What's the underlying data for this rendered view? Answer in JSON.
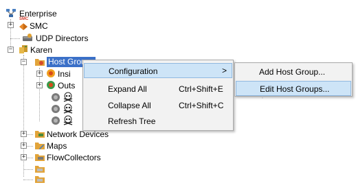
{
  "tree": {
    "enterprise": "Enterprise",
    "smc": "SMC",
    "smc_badge": "SMC",
    "udp_directors": "UDP Directors",
    "karen": "Karen",
    "host_groups": "Host Groups",
    "inside_hosts": "Insi",
    "outside_hosts": "Outs",
    "network_devices": "Network Devices",
    "maps": "Maps",
    "flow_collectors": "FlowCollectors"
  },
  "context_menu": {
    "configuration": "Configuration",
    "configuration_arrow": ">",
    "expand_all": "Expand All",
    "expand_all_shortcut": "Ctrl+Shift+E",
    "collapse_all": "Collapse All",
    "collapse_all_shortcut": "Ctrl+Shift+C",
    "refresh_tree": "Refresh Tree"
  },
  "submenu": {
    "add_host_group": "Add Host Group...",
    "edit_host_groups": "Edit Host Groups..."
  },
  "colors": {
    "selection": "#3b70c8",
    "menu_highlight": "#cde4f7"
  }
}
